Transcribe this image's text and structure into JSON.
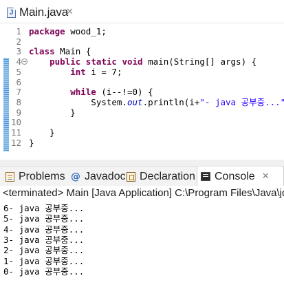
{
  "editor": {
    "tab_title": "Main.java",
    "tab_icon": "java-file-icon",
    "lines": [
      {
        "num": "1",
        "segments": [
          {
            "t": "package ",
            "c": "kw"
          },
          {
            "t": "wood_1;",
            "c": ""
          }
        ]
      },
      {
        "num": "2",
        "segments": []
      },
      {
        "num": "3",
        "segments": [
          {
            "t": "class ",
            "c": "kw"
          },
          {
            "t": "Main {",
            "c": ""
          }
        ]
      },
      {
        "num": "4",
        "segments": [
          {
            "t": "    public ",
            "c": "kw"
          },
          {
            "t": "static ",
            "c": "kw"
          },
          {
            "t": "void ",
            "c": "kw"
          },
          {
            "t": "main(String[] args) {",
            "c": ""
          }
        ]
      },
      {
        "num": "5",
        "segments": [
          {
            "t": "        int ",
            "c": "kw"
          },
          {
            "t": "i = 7;",
            "c": ""
          }
        ]
      },
      {
        "num": "6",
        "segments": []
      },
      {
        "num": "7",
        "segments": [
          {
            "t": "        while ",
            "c": "kw"
          },
          {
            "t": "(i--!=0) {",
            "c": ""
          }
        ]
      },
      {
        "num": "8",
        "segments": [
          {
            "t": "            System.",
            "c": ""
          },
          {
            "t": "out",
            "c": "fld"
          },
          {
            "t": ".println(i+",
            "c": ""
          },
          {
            "t": "\"- java 공부중...\"",
            "c": "str"
          },
          {
            "t": ");",
            "c": ""
          }
        ]
      },
      {
        "num": "9",
        "segments": [
          {
            "t": "        }",
            "c": ""
          }
        ]
      },
      {
        "num": "10",
        "segments": []
      },
      {
        "num": "11",
        "segments": [
          {
            "t": "    }",
            "c": ""
          }
        ]
      },
      {
        "num": "12",
        "segments": [
          {
            "t": "}",
            "c": ""
          }
        ]
      }
    ]
  },
  "views": {
    "tabs": [
      {
        "label": "Problems",
        "icon": "problems-icon",
        "active": false
      },
      {
        "label": "Javadoc",
        "icon": "javadoc-icon",
        "active": false
      },
      {
        "label": "Declaration",
        "icon": "declaration-icon",
        "active": false
      },
      {
        "label": "Console",
        "icon": "console-icon",
        "active": true
      }
    ],
    "console_header": "<terminated> Main [Java Application] C:\\Program Files\\Java\\jdk",
    "output": [
      "6- java 공부중...",
      "5- java 공부중...",
      "4- java 공부중...",
      "3- java 공부중...",
      "2- java 공부중...",
      "1- java 공부중...",
      "0- java 공부중..."
    ]
  }
}
